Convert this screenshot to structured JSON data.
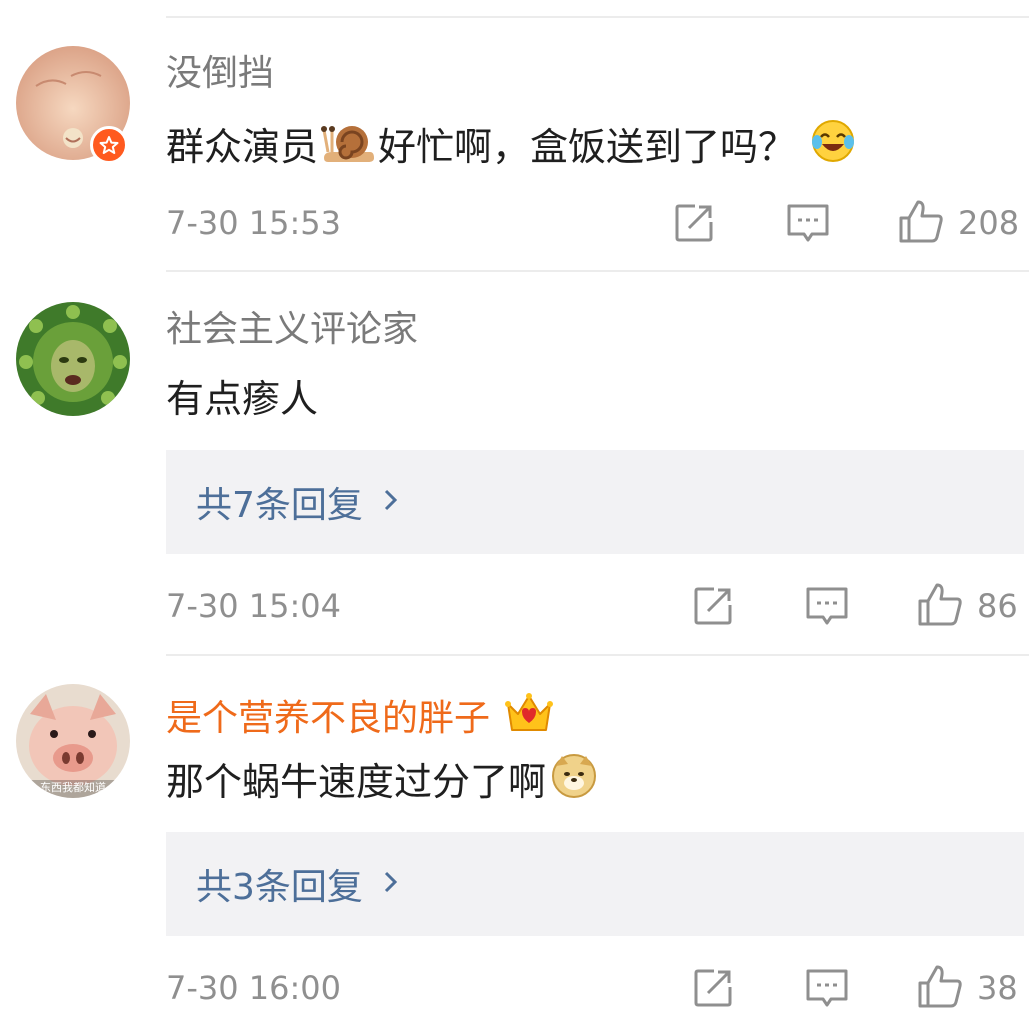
{
  "comments": [
    {
      "username": "没倒挡",
      "content_before": "群众演员",
      "content_after": "好忙啊，盒饭送到了吗？",
      "timestamp": "7-30 15:53",
      "likes": "208",
      "badge_icon": "star-badge-icon"
    },
    {
      "username": "社会主义评论家",
      "content": "有点瘆人",
      "replies": "共7条回复",
      "timestamp": "7-30 15:04",
      "likes": "86"
    },
    {
      "username": "是个营养不良的胖子",
      "content": "那个蜗牛速度过分了啊",
      "replies": "共3条回复",
      "timestamp": "7-30 16:00",
      "likes": "38",
      "username_color": "#ef6a1a"
    }
  ],
  "avatar_caption": "东西我都知道"
}
